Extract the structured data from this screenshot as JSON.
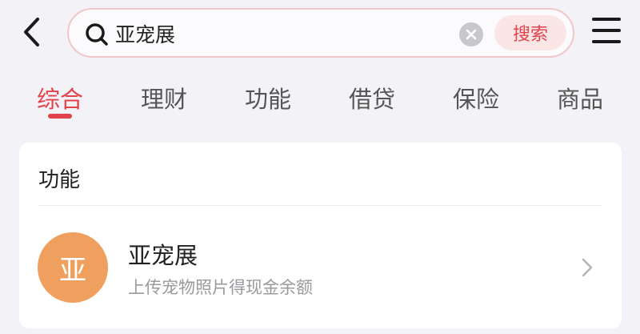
{
  "search": {
    "query": "亚宠展",
    "button_label": "搜索"
  },
  "tabs": [
    {
      "label": "综合",
      "active": true
    },
    {
      "label": "理财",
      "active": false
    },
    {
      "label": "功能",
      "active": false
    },
    {
      "label": "借贷",
      "active": false
    },
    {
      "label": "保险",
      "active": false
    },
    {
      "label": "商品",
      "active": false
    }
  ],
  "section": {
    "title": "功能",
    "items": [
      {
        "avatar_char": "亚",
        "title": "亚宠展",
        "description": "上传宠物照片得现金余额"
      }
    ]
  },
  "colors": {
    "accent": "#e2434b",
    "avatar_bg": "#f0a05e",
    "page_bg": "#f3f2f6"
  },
  "icons": {
    "back": "chevron-left-icon",
    "search": "search-icon",
    "clear": "clear-icon",
    "menu": "menu-icon",
    "row": "chevron-right-icon"
  }
}
